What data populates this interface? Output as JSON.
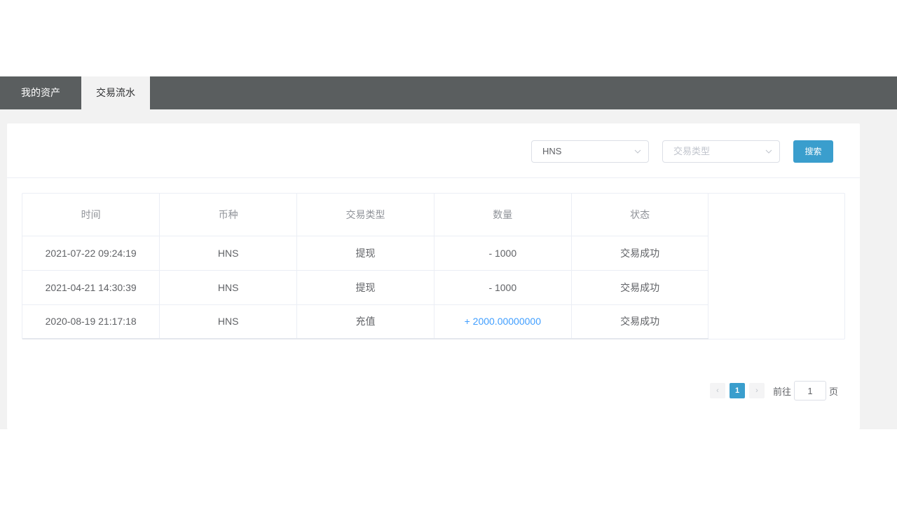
{
  "tabs": [
    {
      "label": "我的资产"
    },
    {
      "label": "交易流水"
    }
  ],
  "filters": {
    "currency_value": "HNS",
    "type_placeholder": "交易类型",
    "search_label": "搜索"
  },
  "table": {
    "headers": [
      "时间",
      "币种",
      "交易类型",
      "数量",
      "状态"
    ],
    "rows": [
      {
        "time": "2021-07-22 09:24:19",
        "currency": "HNS",
        "type": "提现",
        "amount": "- 1000",
        "status": "交易成功"
      },
      {
        "time": "2021-04-21 14:30:39",
        "currency": "HNS",
        "type": "提现",
        "amount": "- 1000",
        "status": "交易成功"
      },
      {
        "time": "2020-08-19 21:17:18",
        "currency": "HNS",
        "type": "充值",
        "amount": "+ 2000.00000000",
        "status": "交易成功"
      }
    ]
  },
  "pagination": {
    "prev_icon": "‹",
    "current_page": "1",
    "next_icon": "›",
    "goto_label": "前往",
    "goto_value": "1",
    "page_suffix": "页"
  },
  "colors": {
    "tabbar_bg": "#5a5e5f",
    "accent": "#3a9ecd",
    "positive_amount": "#409eff"
  }
}
